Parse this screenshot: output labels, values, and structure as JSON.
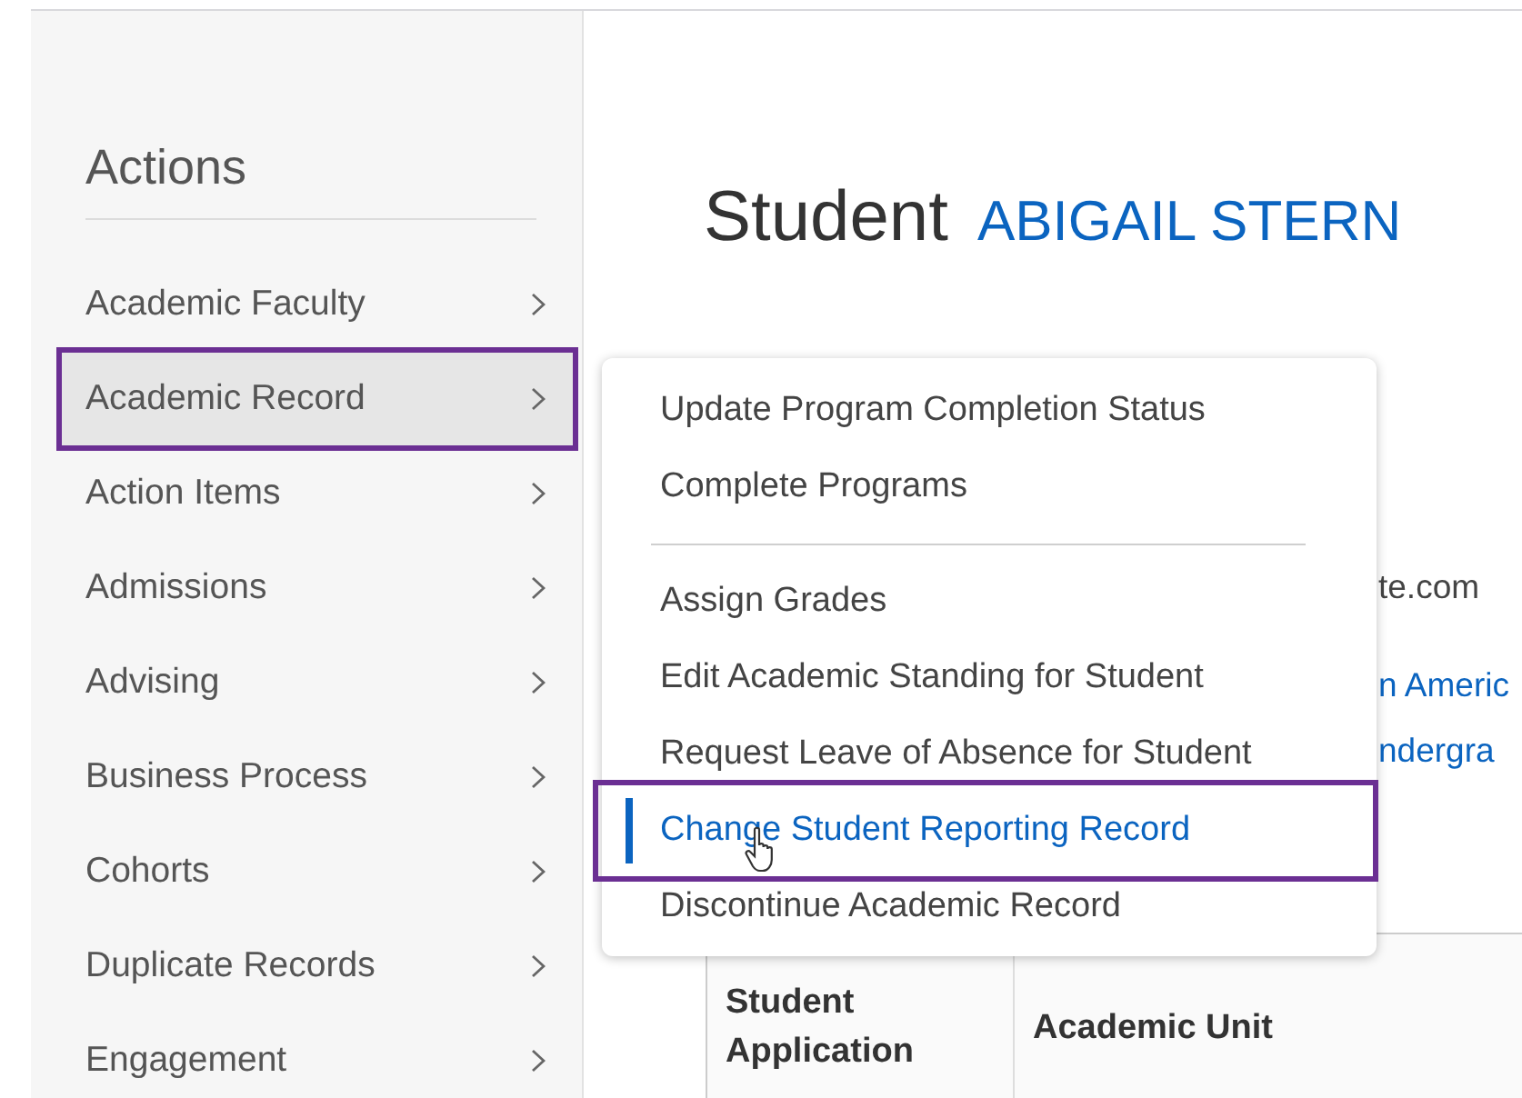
{
  "sidebar": {
    "title": "Actions",
    "items": [
      {
        "label": "Academic Faculty",
        "selected": false,
        "highlighted": false
      },
      {
        "label": "Academic Record",
        "selected": true,
        "highlighted": true
      },
      {
        "label": "Action Items",
        "selected": false,
        "highlighted": false
      },
      {
        "label": "Admissions",
        "selected": false,
        "highlighted": false
      },
      {
        "label": "Advising",
        "selected": false,
        "highlighted": false
      },
      {
        "label": "Business Process",
        "selected": false,
        "highlighted": false
      },
      {
        "label": "Cohorts",
        "selected": false,
        "highlighted": false
      },
      {
        "label": "Duplicate Records",
        "selected": false,
        "highlighted": false
      },
      {
        "label": "Engagement",
        "selected": false,
        "highlighted": false
      }
    ]
  },
  "header": {
    "label": "Student",
    "name": "ABIGAIL STERN"
  },
  "details": [
    {
      "text": "te.com",
      "kind": "plain"
    },
    {
      "text": "n Americ",
      "kind": "link"
    },
    {
      "text": "ndergra",
      "kind": "link"
    }
  ],
  "table": {
    "columns": [
      "Student Application",
      "Academic Unit"
    ]
  },
  "menu": {
    "sections": [
      {
        "items": [
          {
            "label": "Update Program Completion Status",
            "selected": false,
            "highlighted": false
          },
          {
            "label": "Complete Programs",
            "selected": false,
            "highlighted": false
          }
        ]
      },
      {
        "items": [
          {
            "label": "Assign Grades",
            "selected": false,
            "highlighted": false
          },
          {
            "label": "Edit Academic Standing for Student",
            "selected": false,
            "highlighted": false
          },
          {
            "label": "Request Leave of Absence for Student",
            "selected": false,
            "highlighted": false
          },
          {
            "label": "Change Student Reporting Record",
            "selected": true,
            "highlighted": true
          },
          {
            "label": "Discontinue Academic Record",
            "selected": false,
            "highlighted": false
          }
        ]
      }
    ]
  }
}
